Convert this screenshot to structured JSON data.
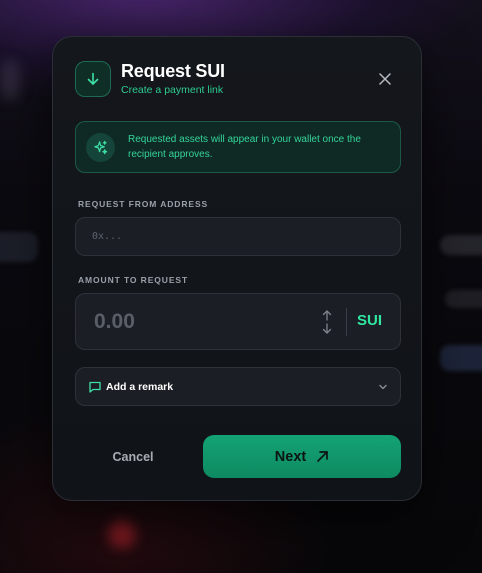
{
  "dialog": {
    "title": "Request SUI",
    "subtitle": "Create a payment link",
    "header_icon": "arrow-down-icon",
    "close_icon": "close-icon"
  },
  "notice": {
    "icon": "sparkle-icon",
    "text": "Requested assets will appear in your wallet once the recipient approves."
  },
  "address_field": {
    "label": "REQUEST FROM ADDRESS",
    "placeholder": "0x...",
    "value": ""
  },
  "amount_field": {
    "label": "AMOUNT TO REQUEST",
    "placeholder": "0.00",
    "value": "",
    "swap_icon": "swap-vertical-icon",
    "currency": "SUI"
  },
  "remark": {
    "icon": "message-icon",
    "label": "Add a remark",
    "chevron": "chevron-down-icon"
  },
  "actions": {
    "cancel_label": "Cancel",
    "next_label": "Next",
    "next_icon": "arrow-up-right-icon"
  },
  "colors": {
    "accent": "#2ee6a0",
    "accent_dark": "#0e8a61",
    "panel": "#14171c",
    "field": "#1b1f25"
  }
}
